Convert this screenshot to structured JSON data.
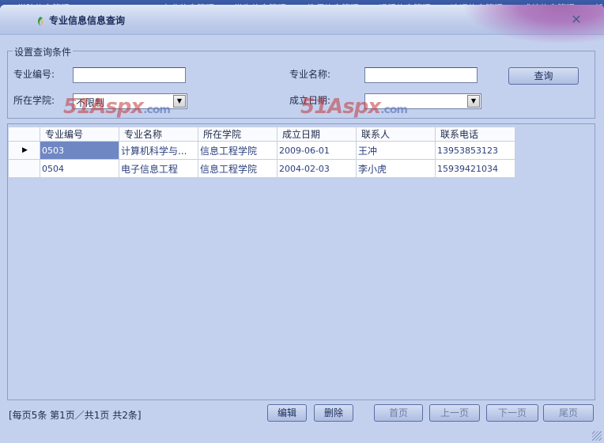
{
  "top_menu": [
    "学院信息管理",
    "专业信息管理",
    "学生信息管理",
    "教师信息管理",
    "课程信息管理",
    "选课信息管理",
    "成绩信息管理",
    "新"
  ],
  "window": {
    "title": "专业信息信息查询",
    "close_glyph": "✕"
  },
  "filters": {
    "group_title": "设置查询条件",
    "major_code_label": "专业编号:",
    "major_code_value": "",
    "major_name_label": "专业名称:",
    "major_name_value": "",
    "college_label": "所在学院:",
    "college_value": "不限制",
    "date_label": "成立日期:",
    "date_value": "",
    "query_button": "查询"
  },
  "watermark": {
    "text": "51Aspx",
    "suffix": ".com"
  },
  "grid": {
    "columns": [
      "专业编号",
      "专业名称",
      "所在学院",
      "成立日期",
      "联系人",
      "联系电话"
    ],
    "current_row_marker": "▶",
    "rows": [
      [
        "0503",
        "计算机科学与...",
        "信息工程学院",
        "2009-06-01",
        "王冲",
        "13953853123"
      ],
      [
        "0504",
        "电子信息工程",
        "信息工程学院",
        "2004-02-03",
        "李小虎",
        "15939421034"
      ]
    ]
  },
  "footer": {
    "page_info": "[每页5条  第1页／共1页    共2条]",
    "edit_button": "编辑",
    "delete_button": "删除",
    "first_button": "首页",
    "prev_button": "上一页",
    "next_button": "下一页",
    "last_button": "尾页"
  },
  "colors": {
    "accent": "#6f88c4",
    "background": "#c4d1ee",
    "watermark": "#c23a3a"
  }
}
